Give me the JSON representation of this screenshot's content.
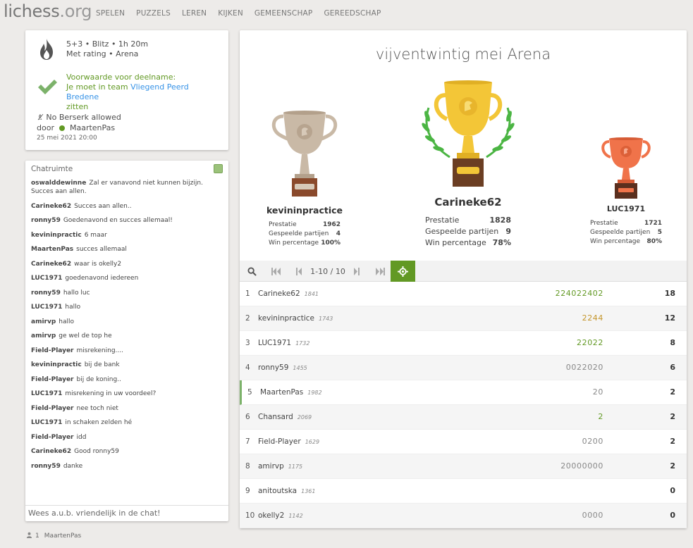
{
  "header": {
    "logo_main": "lichess",
    "logo_suffix": ".org",
    "nav": [
      "SPELEN",
      "PUZZELS",
      "LEREN",
      "KIJKEN",
      "GEMEENSCHAP",
      "GEREEDSCHAP"
    ]
  },
  "info": {
    "line1": "5+3 • Blitz • 1h 20m",
    "line2": "Met rating • Arena",
    "condition_title": "Voorwaarde voor deelname:",
    "condition_prefix": "Je moet in team ",
    "condition_team": "Vliegend Peerd Bredene",
    "condition_suffix": "zitten",
    "berserk": "No Berserk allowed",
    "by_label": "door",
    "organizer": "MaartenPas",
    "date": "25 mei 2021 20:00"
  },
  "chat": {
    "title": "Chatruimte",
    "placeholder": "Wees a.u.b. vriendelijk in de chat!",
    "messages": [
      {
        "user": "oswalddewinne",
        "text": "Zal er vanavond niet kunnen bijzijn. Succes aan allen."
      },
      {
        "user": "Carineke62",
        "text": "Succes aan allen.."
      },
      {
        "user": "ronny59",
        "text": "Goedenavond en succes allemaal!"
      },
      {
        "user": "kevininpractic",
        "text": "6 maar"
      },
      {
        "user": "MaartenPas",
        "text": "succes allemaal"
      },
      {
        "user": "Carineke62",
        "text": "waar is okelly2"
      },
      {
        "user": "LUC1971",
        "text": "goedenavond iedereen"
      },
      {
        "user": "ronny59",
        "text": "hallo luc"
      },
      {
        "user": "LUC1971",
        "text": "hallo"
      },
      {
        "user": "amirvp",
        "text": "hallo"
      },
      {
        "user": "amirvp",
        "text": "ge wel de top he"
      },
      {
        "user": "Field-Player",
        "text": "misrekening...."
      },
      {
        "user": "kevininpractic",
        "text": "bij de bank"
      },
      {
        "user": "Field-Player",
        "text": "bij de koning.."
      },
      {
        "user": "LUC1971",
        "text": "misrekening in uw voordeel?"
      },
      {
        "user": "Field-Player",
        "text": "nee toch niet"
      },
      {
        "user": "LUC1971",
        "text": "in schaken zelden hé"
      },
      {
        "user": "Field-Player",
        "text": "idd"
      },
      {
        "user": "Carineke62",
        "text": "Good ronny59"
      },
      {
        "user": "ronny59",
        "text": "danke"
      }
    ]
  },
  "spectators": {
    "count": "1",
    "name": "MaartenPas"
  },
  "tournament": {
    "title": "vijventwintig mei Arena",
    "podium": {
      "first": {
        "name": "Carineke62",
        "perf": "1828",
        "games": "9",
        "win": "78%"
      },
      "second": {
        "name": "kevininpractice",
        "perf": "1962",
        "games": "4",
        "win": "100%"
      },
      "third": {
        "name": "LUC1971",
        "perf": "1721",
        "games": "5",
        "win": "80%"
      }
    },
    "stat_labels": {
      "perf": "Prestatie",
      "games": "Gespeelde partijen",
      "win": "Win percentage"
    },
    "pager": {
      "label": "1-10 / 10"
    },
    "standings": [
      {
        "rank": "1",
        "name": "Carineke62",
        "rating": "1841",
        "sheet": "224022402",
        "score": "18",
        "color": "#629924"
      },
      {
        "rank": "2",
        "name": "kevininpractice",
        "rating": "1743",
        "sheet": "2244",
        "score": "12",
        "color": "#c4952a"
      },
      {
        "rank": "3",
        "name": "LUC1971",
        "rating": "1732",
        "sheet": "22022",
        "score": "8",
        "color": "#629924"
      },
      {
        "rank": "4",
        "name": "ronny59",
        "rating": "1455",
        "sheet": "0022020",
        "score": "6",
        "color": "#888888"
      },
      {
        "rank": "5",
        "name": "MaartenPas",
        "rating": "1982",
        "sheet": "20",
        "score": "2",
        "color": "#888888"
      },
      {
        "rank": "6",
        "name": "Chansard",
        "rating": "2069",
        "sheet": "2",
        "score": "2",
        "color": "#629924"
      },
      {
        "rank": "7",
        "name": "Field-Player",
        "rating": "1629",
        "sheet": "0200",
        "score": "2",
        "color": "#888888"
      },
      {
        "rank": "8",
        "name": "amirvp",
        "rating": "1175",
        "sheet": "20000000",
        "score": "2",
        "color": "#888888"
      },
      {
        "rank": "9",
        "name": "anitoutska",
        "rating": "1361",
        "sheet": "",
        "score": "0",
        "color": "#888888"
      },
      {
        "rank": "10",
        "name": "okelly2",
        "rating": "1142",
        "sheet": "0000",
        "score": "0",
        "color": "#888888"
      }
    ]
  }
}
